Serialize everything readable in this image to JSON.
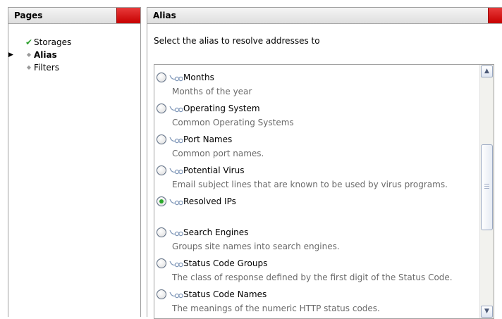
{
  "left_panel": {
    "title": "Pages",
    "items": [
      {
        "label": "Storages",
        "icon": "check-icon",
        "bold": false,
        "selected": false
      },
      {
        "label": "Alias",
        "icon": "dot-icon",
        "bold": true,
        "selected": true
      },
      {
        "label": "Filters",
        "icon": "dot-icon",
        "bold": false,
        "selected": false
      }
    ]
  },
  "right_panel": {
    "title": "Alias",
    "instruction": "Select the alias to resolve addresses to",
    "options": [
      {
        "name": "Months",
        "description": "Months of the year",
        "checked": false
      },
      {
        "name": "Operating System",
        "description": "Common Operating Systems",
        "checked": false
      },
      {
        "name": "Port Names",
        "description": "Common port names.",
        "checked": false
      },
      {
        "name": "Potential Virus",
        "description": "Email subject lines that are known to be used by virus programs.",
        "checked": false
      },
      {
        "name": "Resolved IPs",
        "description": "",
        "checked": true
      },
      {
        "name": "Search Engines",
        "description": "Groups site names into search engines.",
        "checked": false
      },
      {
        "name": "Status Code Groups",
        "description": "The class of response defined by the first digit of the Status Code.",
        "checked": false
      },
      {
        "name": "Status Code Names",
        "description": "The meanings of the numeric HTTP status codes.",
        "checked": false
      }
    ]
  },
  "colors": {
    "accent_red": "#d10000",
    "check_green": "#2ea02e",
    "radio_dot": "#2aa82a"
  }
}
